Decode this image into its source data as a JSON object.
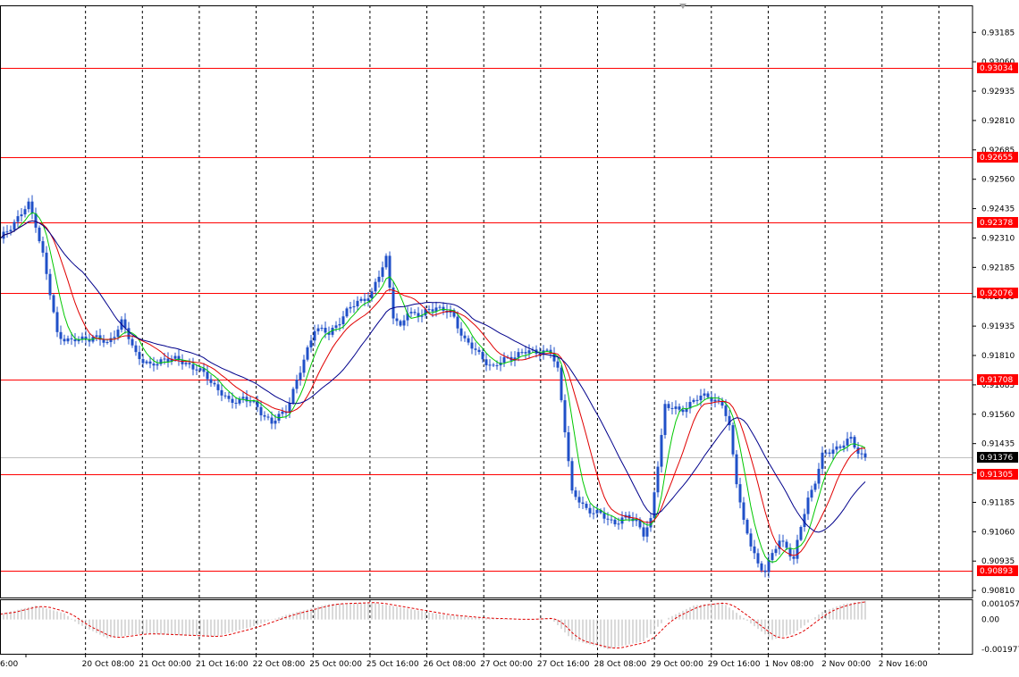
{
  "chart_data": {
    "type": "candlestick",
    "time_ticks": [
      "6:00",
      "20 Oct 08:00",
      "21 Oct 00:00",
      "21 Oct 16:00",
      "22 Oct 08:00",
      "25 Oct 00:00",
      "25 Oct 16:00",
      "26 Oct 08:00",
      "27 Oct 00:00",
      "27 Oct 16:00",
      "28 Oct 08:00",
      "29 Oct 00:00",
      "29 Oct 16:00",
      "1 Nov 08:00",
      "2 Nov 00:00",
      "2 Nov 16:00"
    ],
    "price_ticks": [
      "0.93185",
      "0.93060",
      "0.92935",
      "0.92810",
      "0.92685",
      "0.92560",
      "0.92435",
      "0.92310",
      "0.92185",
      "0.92060",
      "0.91935",
      "0.91810",
      "0.91685",
      "0.91560",
      "0.91435",
      "0.91310",
      "0.91185",
      "0.91060",
      "0.90935",
      "0.90810"
    ],
    "price_range": [
      0.9078,
      0.933
    ],
    "horizontal_levels": [
      {
        "label": "0.93034",
        "value": 0.93034
      },
      {
        "label": "0.92655",
        "value": 0.92655
      },
      {
        "label": "0.92378",
        "value": 0.92378
      },
      {
        "label": "0.92076",
        "value": 0.92076
      },
      {
        "label": "0.91708",
        "value": 0.91708
      },
      {
        "label": "0.91305",
        "value": 0.91305
      },
      {
        "label": "0.90893",
        "value": 0.90893
      }
    ],
    "current_price": {
      "label": "0.91376",
      "value": 0.91376
    },
    "close_path": [
      [
        0,
        0.923
      ],
      [
        4,
        0.9238
      ],
      [
        8,
        0.9245
      ],
      [
        10,
        0.9237
      ],
      [
        12,
        0.9224
      ],
      [
        16,
        0.919
      ],
      [
        20,
        0.9187
      ],
      [
        26,
        0.9189
      ],
      [
        30,
        0.9186
      ],
      [
        34,
        0.9195
      ],
      [
        38,
        0.9182
      ],
      [
        42,
        0.9176
      ],
      [
        46,
        0.918
      ],
      [
        52,
        0.9178
      ],
      [
        58,
        0.9172
      ],
      [
        64,
        0.9161
      ],
      [
        68,
        0.9163
      ],
      [
        72,
        0.9159
      ],
      [
        76,
        0.9152
      ],
      [
        80,
        0.9158
      ],
      [
        84,
        0.9174
      ],
      [
        88,
        0.9193
      ],
      [
        92,
        0.919
      ],
      [
        96,
        0.9198
      ],
      [
        100,
        0.9204
      ],
      [
        104,
        0.9207
      ],
      [
        108,
        0.9223
      ],
      [
        110,
        0.9198
      ],
      [
        112,
        0.9192
      ],
      [
        114,
        0.92
      ],
      [
        118,
        0.9198
      ],
      [
        122,
        0.9202
      ],
      [
        126,
        0.9199
      ],
      [
        130,
        0.9188
      ],
      [
        134,
        0.9181
      ],
      [
        138,
        0.9176
      ],
      [
        142,
        0.918
      ],
      [
        146,
        0.9182
      ],
      [
        150,
        0.9183
      ],
      [
        154,
        0.9182
      ],
      [
        156,
        0.9175
      ],
      [
        158,
        0.915
      ],
      [
        160,
        0.9122
      ],
      [
        164,
        0.9116
      ],
      [
        168,
        0.9113
      ],
      [
        172,
        0.911
      ],
      [
        176,
        0.9112
      ],
      [
        178,
        0.9111
      ],
      [
        180,
        0.9105
      ],
      [
        182,
        0.911
      ],
      [
        186,
        0.916
      ],
      [
        190,
        0.9157
      ],
      [
        194,
        0.9162
      ],
      [
        198,
        0.9164
      ],
      [
        202,
        0.916
      ],
      [
        204,
        0.915
      ],
      [
        206,
        0.9128
      ],
      [
        208,
        0.911
      ],
      [
        210,
        0.91
      ],
      [
        212,
        0.9092
      ],
      [
        214,
        0.909
      ],
      [
        216,
        0.9096
      ],
      [
        218,
        0.9102
      ],
      [
        220,
        0.91
      ],
      [
        222,
        0.9094
      ],
      [
        224,
        0.9108
      ],
      [
        226,
        0.912
      ],
      [
        228,
        0.9128
      ],
      [
        230,
        0.9138
      ],
      [
        234,
        0.9142
      ],
      [
        238,
        0.9145
      ],
      [
        240,
        0.914
      ],
      [
        242,
        0.9138
      ]
    ],
    "moving_averages": [
      {
        "color": "#00c800",
        "period": 6
      },
      {
        "color": "#e00000",
        "period": 12
      },
      {
        "color": "#00008b",
        "period": 24
      }
    ],
    "oscillator": {
      "ticks": [
        "0.001057",
        "0.00",
        "-0.001977"
      ],
      "range": [
        -0.0022,
        0.0013
      ],
      "histogram_color": "#b4b4b4",
      "signal_color": "#e00000",
      "path": [
        [
          0,
          0.00035
        ],
        [
          10,
          0.0009
        ],
        [
          18,
          0.0004
        ],
        [
          22,
          -0.0003
        ],
        [
          30,
          -0.0012
        ],
        [
          40,
          -0.0009
        ],
        [
          50,
          -0.001
        ],
        [
          60,
          -0.0011
        ],
        [
          70,
          -0.0005
        ],
        [
          80,
          0.0003
        ],
        [
          92,
          0.001
        ],
        [
          104,
          0.0011
        ],
        [
          114,
          0.0007
        ],
        [
          124,
          0.0003
        ],
        [
          134,
          0.0001
        ],
        [
          146,
          0.0
        ],
        [
          154,
          0.0001
        ],
        [
          160,
          -0.0013
        ],
        [
          170,
          -0.0019
        ],
        [
          180,
          -0.0014
        ],
        [
          186,
          0.0
        ],
        [
          194,
          0.0009
        ],
        [
          202,
          0.0011
        ],
        [
          208,
          0.0001
        ],
        [
          216,
          -0.0013
        ],
        [
          222,
          -0.0009
        ],
        [
          230,
          0.0005
        ],
        [
          236,
          0.001
        ],
        [
          242,
          0.0012
        ]
      ]
    }
  }
}
